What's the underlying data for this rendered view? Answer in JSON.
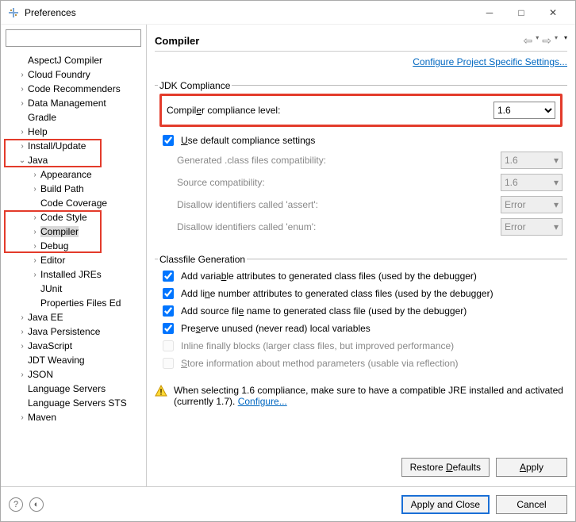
{
  "window": {
    "title": "Preferences"
  },
  "tree": {
    "items": [
      {
        "label": "AspectJ Compiler",
        "depth": 1,
        "chev": "",
        "hl": false
      },
      {
        "label": "Cloud Foundry",
        "depth": 1,
        "chev": ">",
        "hl": false
      },
      {
        "label": "Code Recommenders",
        "depth": 1,
        "chev": ">",
        "hl": false
      },
      {
        "label": "Data Management",
        "depth": 1,
        "chev": ">",
        "hl": false
      },
      {
        "label": "Gradle",
        "depth": 1,
        "chev": "",
        "hl": false
      },
      {
        "label": "Help",
        "depth": 1,
        "chev": ">",
        "hl": false
      },
      {
        "label": "Install/Update",
        "depth": 1,
        "chev": ">",
        "hl": true
      },
      {
        "label": "Java",
        "depth": 1,
        "chev": "v",
        "hl": true
      },
      {
        "label": "Appearance",
        "depth": 2,
        "chev": ">",
        "hl": false
      },
      {
        "label": "Build Path",
        "depth": 2,
        "chev": ">",
        "hl": false
      },
      {
        "label": "Code Coverage",
        "depth": 2,
        "chev": "",
        "hl": false
      },
      {
        "label": "Code Style",
        "depth": 2,
        "chev": ">",
        "hl": true
      },
      {
        "label": "Compiler",
        "depth": 2,
        "chev": ">",
        "hl": true,
        "selected": true
      },
      {
        "label": "Debug",
        "depth": 2,
        "chev": ">",
        "hl": true
      },
      {
        "label": "Editor",
        "depth": 2,
        "chev": ">",
        "hl": false
      },
      {
        "label": "Installed JREs",
        "depth": 2,
        "chev": ">",
        "hl": false
      },
      {
        "label": "JUnit",
        "depth": 2,
        "chev": "",
        "hl": false
      },
      {
        "label": "Properties Files Ed",
        "depth": 2,
        "chev": "",
        "hl": false
      },
      {
        "label": "Java EE",
        "depth": 1,
        "chev": ">",
        "hl": false
      },
      {
        "label": "Java Persistence",
        "depth": 1,
        "chev": ">",
        "hl": false
      },
      {
        "label": "JavaScript",
        "depth": 1,
        "chev": ">",
        "hl": false
      },
      {
        "label": "JDT Weaving",
        "depth": 1,
        "chev": "",
        "hl": false
      },
      {
        "label": "JSON",
        "depth": 1,
        "chev": ">",
        "hl": false
      },
      {
        "label": "Language Servers",
        "depth": 1,
        "chev": "",
        "hl": false
      },
      {
        "label": "Language Servers STS",
        "depth": 1,
        "chev": "",
        "hl": false
      },
      {
        "label": "Maven",
        "depth": 1,
        "chev": ">",
        "hl": false
      }
    ]
  },
  "main": {
    "title": "Compiler",
    "link": "Configure Project Specific Settings...",
    "jdk": {
      "group": "JDK Compliance",
      "compliance_label": "Compiler compliance level:",
      "compliance_value": "1.6",
      "use_default_label": "Use default compliance settings",
      "gen_class_label": "Generated .class files compatibility:",
      "gen_class_value": "1.6",
      "src_compat_label": "Source compatibility:",
      "src_compat_value": "1.6",
      "disallow_assert_label": "Disallow identifiers called 'assert':",
      "disallow_assert_value": "Error",
      "disallow_enum_label": "Disallow identifiers called 'enum':",
      "disallow_enum_value": "Error"
    },
    "classfile": {
      "group": "Classfile Generation",
      "cb1": "Add variable attributes to generated class files (used by the debugger)",
      "cb2": "Add line number attributes to generated class files (used by the debugger)",
      "cb3": "Add source file name to generated class file (used by the debugger)",
      "cb4": "Preserve unused (never read) local variables",
      "cb5": "Inline finally blocks (larger class files, but improved performance)",
      "cb6": "Store information about method parameters (usable via reflection)"
    },
    "warning_text": "When selecting 1.6 compliance, make sure to have a compatible JRE installed and activated (currently 1.7). ",
    "warning_link": "Configure...",
    "restore": "Restore Defaults",
    "apply": "Apply"
  },
  "footer": {
    "apply_close": "Apply and Close",
    "cancel": "Cancel"
  }
}
